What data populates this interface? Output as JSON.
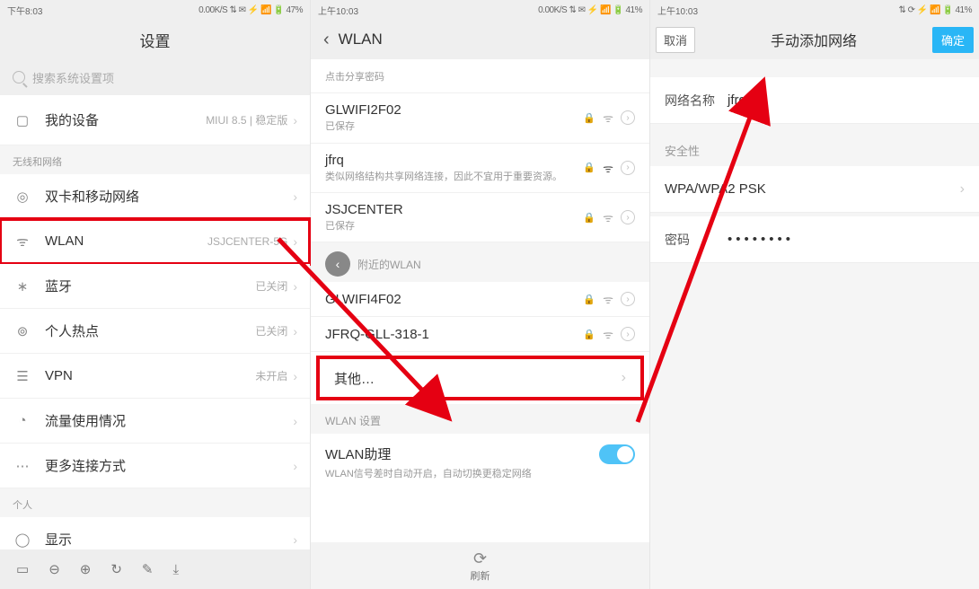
{
  "status": {
    "left1": "下午8:03",
    "right1": "0.00K/S ⇅ ✉ ⚡ 📶 🔋 47%",
    "left2": "上午10:03",
    "right2": "0.00K/S ⇅ ✉ ⚡ 📶 🔋 41%",
    "left3": "上午10:03",
    "right3": "⇅ ⟳ ⚡ 📶 🔋 41%"
  },
  "p1": {
    "title": "设置",
    "search_placeholder": "搜索系统设置项",
    "my_device": "我的设备",
    "my_device_sub": "MIUI 8.5 | 稳定版",
    "section_net": "无线和网络",
    "dual_sim": "双卡和移动网络",
    "wlan": "WLAN",
    "wlan_val": "JSJCENTER-5G",
    "bt": "蓝牙",
    "bt_val": "已关闭",
    "hotspot": "个人热点",
    "hotspot_val": "已关闭",
    "vpn": "VPN",
    "vpn_val": "未开启",
    "data_usage": "流量使用情况",
    "more_conn": "更多连接方式",
    "section_personal": "个人",
    "display": "显示"
  },
  "p2": {
    "back": "‹",
    "title": "WLAN",
    "share": "点击分享密码",
    "n1": "GLWIFI2F02",
    "n1_sub": "已保存",
    "n2": "jfrq",
    "n2_sub": "类似网络结构共享网络连接，因此不宜用于重要资源。",
    "n3": "JSJCENTER",
    "n3_sub": "已保存",
    "sub_available_prefix": "附近的WLAN",
    "n4": "GLWIFI4F02",
    "n5": "JFRQ-GLL-318-1",
    "other": "其他…",
    "sub_settings": "WLAN 设置",
    "assist": "WLAN助理",
    "assist_sub": "WLAN信号差时自动开启，自动切换更稳定网络",
    "refresh": "刷新"
  },
  "p3": {
    "cancel": "取消",
    "title": "手动添加网络",
    "ok": "确定",
    "name_label": "网络名称",
    "name_val": "jfrq",
    "sec_label": "安全性",
    "sec_val": "WPA/WPA2 PSK",
    "pwd_label": "密码",
    "pwd_val": "••••••••"
  }
}
